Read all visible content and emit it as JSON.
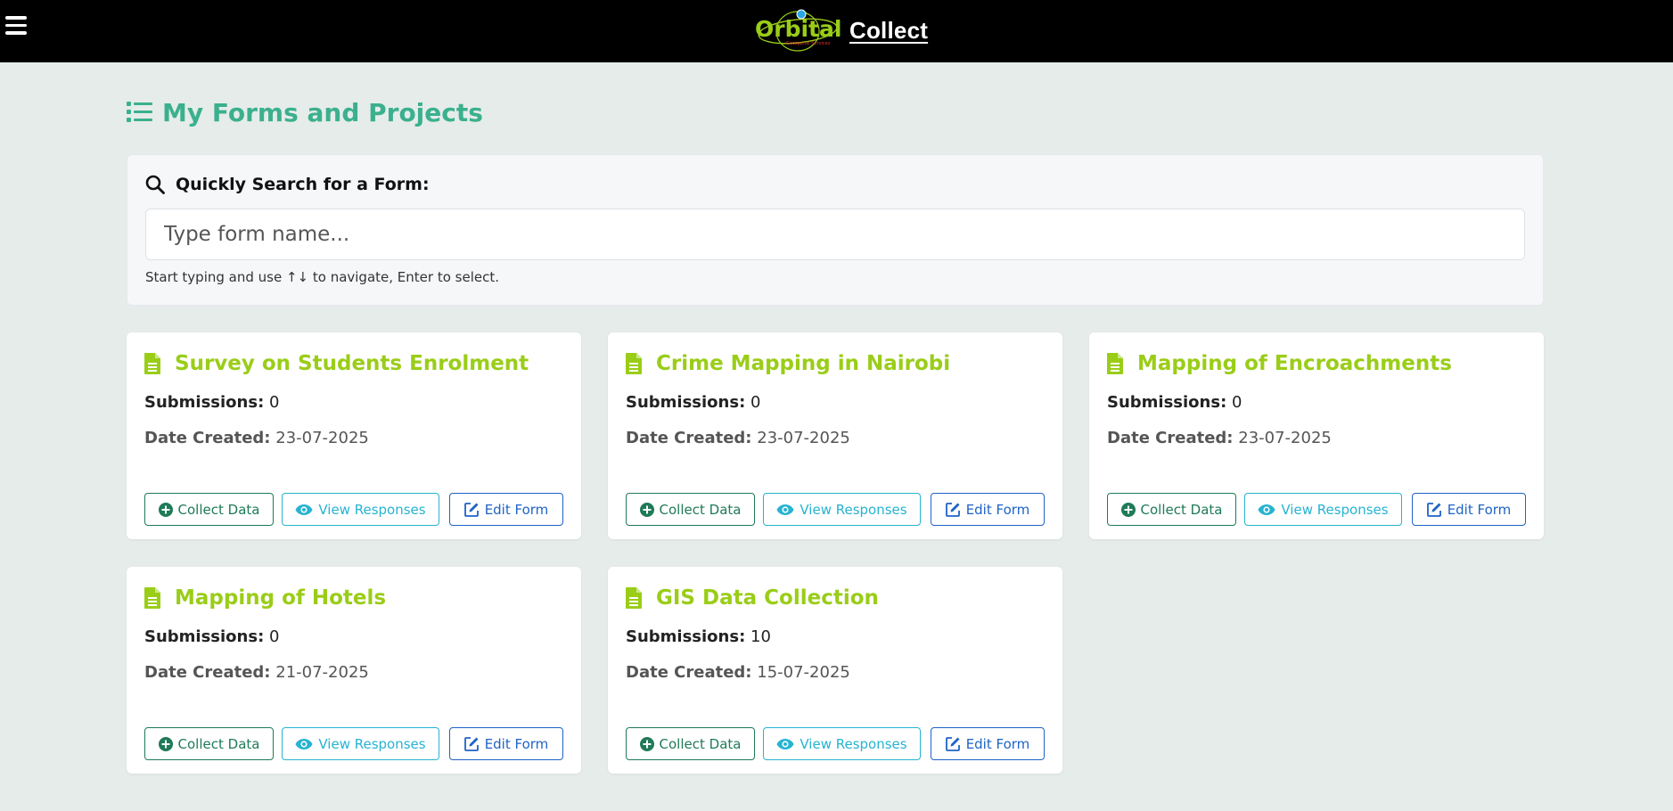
{
  "header": {
    "logo_text": "Orbital",
    "logo_subtext": "Geospatial Services",
    "brand_name": "Collect"
  },
  "page": {
    "title": "My Forms and Projects"
  },
  "search": {
    "label": "Quickly Search for a Form:",
    "placeholder": "Type form name...",
    "value": "",
    "hint": "Start typing and use ↑↓ to navigate, Enter to select."
  },
  "card_labels": {
    "submissions": "Submissions:",
    "date_created": "Date Created:",
    "collect": "Collect Data",
    "view": "View Responses",
    "edit": "Edit Form"
  },
  "forms": [
    {
      "title": "Survey on Students Enrolment",
      "submissions": "0",
      "date_created": "23-07-2025"
    },
    {
      "title": "Crime Mapping in Nairobi",
      "submissions": "0",
      "date_created": "23-07-2025"
    },
    {
      "title": "Mapping of Encroachments",
      "submissions": "0",
      "date_created": "23-07-2025"
    },
    {
      "title": "Mapping of Hotels",
      "submissions": "0",
      "date_created": "21-07-2025"
    },
    {
      "title": "GIS Data Collection",
      "submissions": "10",
      "date_created": "15-07-2025"
    }
  ],
  "colors": {
    "header_bg": "#000000",
    "page_bg": "#e6ecea",
    "title_green": "#3bb08d",
    "card_title": "#9acd18",
    "collect": "#1f7a57",
    "view": "#27b3d1",
    "edit": "#1f63c6"
  },
  "icons": {
    "menu": "hamburger-menu-icon",
    "title": "list-icon",
    "search": "search-icon",
    "card": "file-document-icon",
    "collect": "plus-circle-icon",
    "view": "eye-icon",
    "edit": "edit-icon"
  }
}
